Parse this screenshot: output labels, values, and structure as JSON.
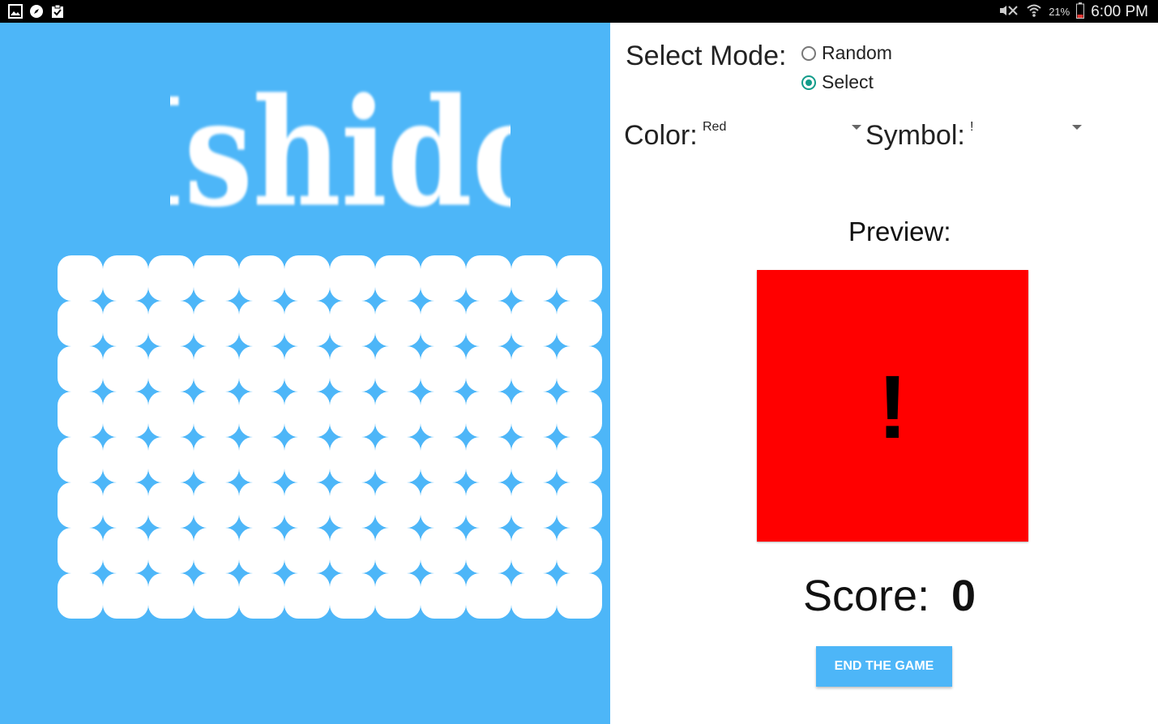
{
  "status_bar": {
    "left_icons": [
      "gallery-icon",
      "compass-icon",
      "clipboard-icon"
    ],
    "battery": "21%",
    "time": "6:00 PM"
  },
  "game": {
    "title": "Ishido",
    "board": {
      "rows": 8,
      "columns": 12
    }
  },
  "controls": {
    "mode_label": "Select Mode:",
    "mode_options": [
      {
        "label": "Random",
        "selected": false
      },
      {
        "label": "Select",
        "selected": true
      }
    ],
    "color_label": "Color:",
    "color_value": "Red",
    "symbol_label": "Symbol:",
    "symbol_value": "!"
  },
  "preview": {
    "label": "Preview:",
    "color": "#ff0000",
    "symbol": "!"
  },
  "score": {
    "label": "Score:",
    "value": "0"
  },
  "end_button_label": "END THE GAME",
  "colors": {
    "accent": "#4db6f8",
    "radio_selected": "#129c8a"
  }
}
